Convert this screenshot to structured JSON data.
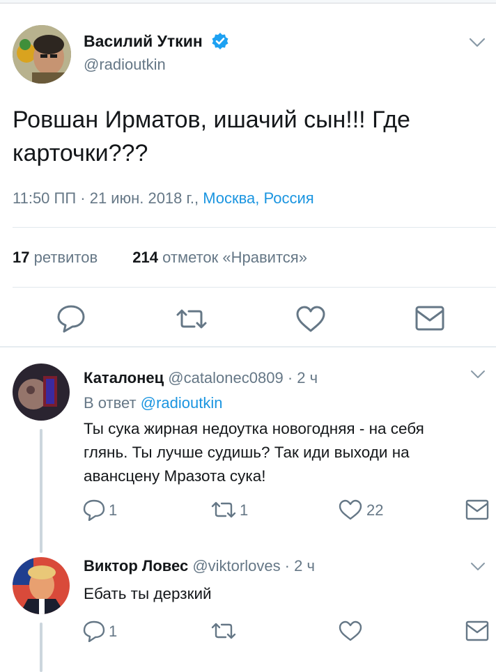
{
  "main_tweet": {
    "author_name": "Василий Уткин",
    "author_handle": "@radioutkin",
    "text_line1": "Ровшан Ирматов, ишачий сын!!! Где",
    "text_line2": "карточки???",
    "timestamp": "11:50 ПП · 21 июн. 2018 г., ",
    "location": "Москва, Россия",
    "retweets_count": "17",
    "retweets_label": "ретвитов",
    "likes_count": "214",
    "likes_label": "отметок «Нравится»"
  },
  "replies": [
    {
      "author_name": "Каталонец",
      "author_handle": "@catalonec0809 · 2 ч",
      "reply_to_prefix": "В ответ ",
      "reply_to_handle": "@radioutkin",
      "text_line1": "Ты сука жирная недоутка новогодняя - на себя",
      "text_line2": "глянь. Ты лучше судишь? Так иди выходи на",
      "text_line3": "авансцену Мразота сука!",
      "reply_count": "1",
      "retweet_count": "1",
      "like_count": "22"
    },
    {
      "author_name": "Виктор Ловес",
      "author_handle": "@viktorloves · 2 ч",
      "text_line1": "Ебать ты дерзкий",
      "reply_count": "1"
    }
  ],
  "colors": {
    "verified": "#1da1f2",
    "link": "#1b95e0",
    "icon": "#657786"
  },
  "icons": [
    "verified-badge-icon",
    "chevron-down-icon",
    "reply-icon",
    "retweet-icon",
    "like-icon",
    "share-icon"
  ]
}
